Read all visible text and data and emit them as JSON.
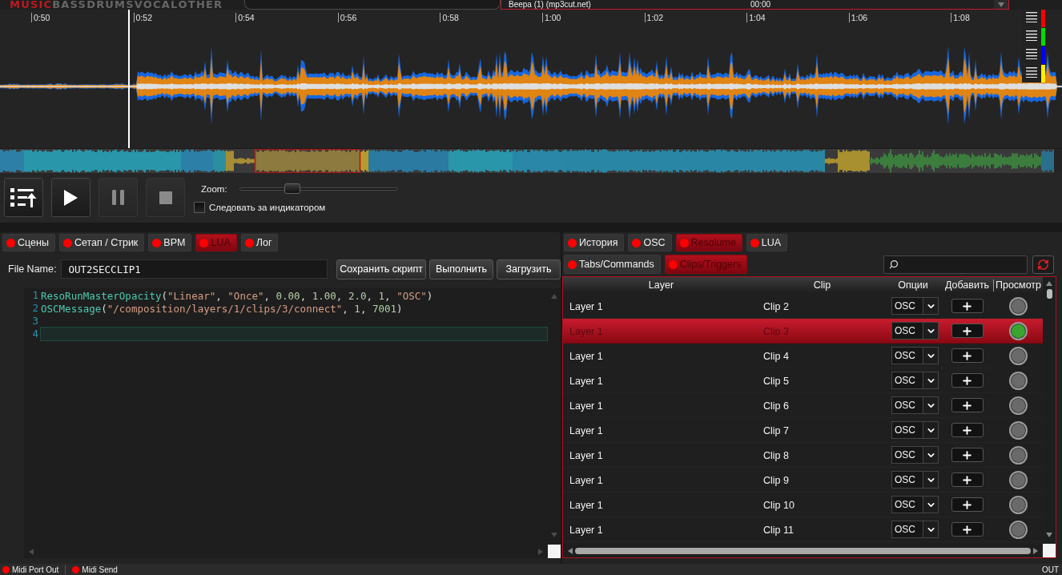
{
  "stems": [
    {
      "label": "MUSIC",
      "selected": true
    },
    {
      "label": "BASS",
      "selected": false
    },
    {
      "label": "DRUMS",
      "selected": false
    },
    {
      "label": "VOCAL",
      "selected": false
    },
    {
      "label": "OTHER",
      "selected": false
    }
  ],
  "track_selector": {
    "name": "Beepa (1) (mp3cut.net)",
    "time": "00:00"
  },
  "timeline": {
    "ticks": [
      "0:50",
      "0:52",
      "0:54",
      "0:56",
      "0:58",
      "1:00",
      "1:02",
      "1:04",
      "1:06",
      "1:08"
    ]
  },
  "lanes": [
    {
      "color": "#ff0000"
    },
    {
      "color": "#00dd00"
    },
    {
      "color": "#0000ff"
    },
    {
      "color": "#ffee00"
    }
  ],
  "transport": {
    "buttons": [
      {
        "kind": "playlist",
        "disabled": false
      },
      {
        "kind": "play",
        "disabled": false
      },
      {
        "kind": "pause",
        "disabled": true
      },
      {
        "kind": "stop",
        "disabled": true
      }
    ],
    "zoom": {
      "label": "Zoom:",
      "level": 0.31
    },
    "follow": {
      "label": "Следовать за индикатором",
      "checked": false
    }
  },
  "left_panel": {
    "tabs": [
      {
        "label": "Сцены",
        "selected": false
      },
      {
        "label": "Сетап / Стрик",
        "selected": false
      },
      {
        "label": "BPM",
        "selected": false
      },
      {
        "label": "LUA",
        "selected": true
      },
      {
        "label": "Лог",
        "selected": false
      }
    ],
    "file_name": {
      "label": "File Name:",
      "value": "OUT2SECCLIP1"
    },
    "buttons": [
      "Сохранить скрипт",
      "Выполнить",
      "Загрузить"
    ],
    "code_lines": [
      {
        "number": "1",
        "current": false,
        "tokens": [
          {
            "kind": "function",
            "text": "ResoRunMasterOpacity"
          },
          {
            "kind": "punct",
            "text": "("
          },
          {
            "kind": "string",
            "text": "\"Linear\""
          },
          {
            "kind": "punct",
            "text": ", "
          },
          {
            "kind": "string",
            "text": "\"Once\""
          },
          {
            "kind": "punct",
            "text": ", "
          },
          {
            "kind": "number",
            "text": "0.00"
          },
          {
            "kind": "punct",
            "text": ", "
          },
          {
            "kind": "number",
            "text": "1.00"
          },
          {
            "kind": "punct",
            "text": ", "
          },
          {
            "kind": "number",
            "text": "2.0"
          },
          {
            "kind": "punct",
            "text": ", "
          },
          {
            "kind": "number",
            "text": "1"
          },
          {
            "kind": "punct",
            "text": ", "
          },
          {
            "kind": "string",
            "text": "\"OSC\""
          },
          {
            "kind": "punct",
            "text": ")"
          }
        ]
      },
      {
        "number": "2",
        "current": false,
        "tokens": [
          {
            "kind": "function",
            "text": "OSCMessage"
          },
          {
            "kind": "punct",
            "text": "("
          },
          {
            "kind": "string",
            "text": "\"/composition/layers/1/clips/3/connect\""
          },
          {
            "kind": "punct",
            "text": ", "
          },
          {
            "kind": "number",
            "text": "1"
          },
          {
            "kind": "punct",
            "text": ", "
          },
          {
            "kind": "number",
            "text": "7001"
          },
          {
            "kind": "punct",
            "text": ")"
          }
        ]
      },
      {
        "number": "3",
        "current": false
      },
      {
        "number": "4",
        "current": true
      }
    ]
  },
  "right_panel": {
    "tabs": [
      {
        "label": "История",
        "selected": false
      },
      {
        "label": "OSC",
        "selected": false
      },
      {
        "label": "Resolume",
        "selected": true
      },
      {
        "label": "LUA",
        "selected": false
      }
    ],
    "subtabs": [
      {
        "label": "Tabs/Commands",
        "selected": false
      },
      {
        "label": "Clips/Triggers",
        "selected": true
      }
    ],
    "table": {
      "columns": [
        "Layer",
        "Clip",
        "Опции",
        "Добавить",
        "Просмотр"
      ],
      "rows": [
        {
          "layer": "Layer 1",
          "clip": "Clip 2",
          "option": "OSC",
          "selected": false,
          "preview_active": false
        },
        {
          "layer": "Layer 1",
          "clip": "Clip 3",
          "option": "OSC",
          "selected": true,
          "preview_active": true
        },
        {
          "layer": "Layer 1",
          "clip": "Clip 4",
          "option": "OSC",
          "selected": false,
          "preview_active": false
        },
        {
          "layer": "Layer 1",
          "clip": "Clip 5",
          "option": "OSC",
          "selected": false,
          "preview_active": false
        },
        {
          "layer": "Layer 1",
          "clip": "Clip 6",
          "option": "OSC",
          "selected": false,
          "preview_active": false
        },
        {
          "layer": "Layer 1",
          "clip": "Clip 7",
          "option": "OSC",
          "selected": false,
          "preview_active": false
        },
        {
          "layer": "Layer 1",
          "clip": "Clip 8",
          "option": "OSC",
          "selected": false,
          "preview_active": false
        },
        {
          "layer": "Layer 1",
          "clip": "Clip 9",
          "option": "OSC",
          "selected": false,
          "preview_active": false
        },
        {
          "layer": "Layer 1",
          "clip": "Clip 10",
          "option": "OSC",
          "selected": false,
          "preview_active": false
        },
        {
          "layer": "Layer 1",
          "clip": "Clip 11",
          "option": "OSC",
          "selected": false,
          "preview_active": false
        }
      ]
    }
  },
  "status_bar": [
    {
      "kind": "indicator",
      "label": "Midi Port Out"
    },
    {
      "kind": "indicator",
      "label": "Midi Send"
    },
    {
      "kind": "text",
      "label": "OUT"
    }
  ]
}
